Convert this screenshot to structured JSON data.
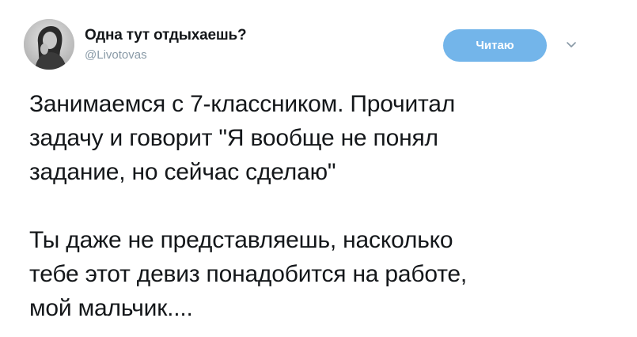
{
  "author": {
    "display_name": "Одна тут отдыхаешь?",
    "handle": "@Livotovas",
    "avatar_icon": "portrait-photo"
  },
  "actions": {
    "follow_label": "Читаю",
    "menu_icon": "chevron-down-icon"
  },
  "tweet": {
    "paragraphs": [
      "Занимаемся с 7-классником. Прочитал\nзадачу и говорит \"Я вообще не понял\nзадание, но сейчас сделаю\"",
      "Ты даже не представляешь, насколько\nтебе этот девиз понадобится на работе,\nмой мальчик...."
    ]
  },
  "colors": {
    "follow_button_bg": "#73b5ea",
    "handle_text": "#8899a6",
    "body_text": "#14171a"
  }
}
